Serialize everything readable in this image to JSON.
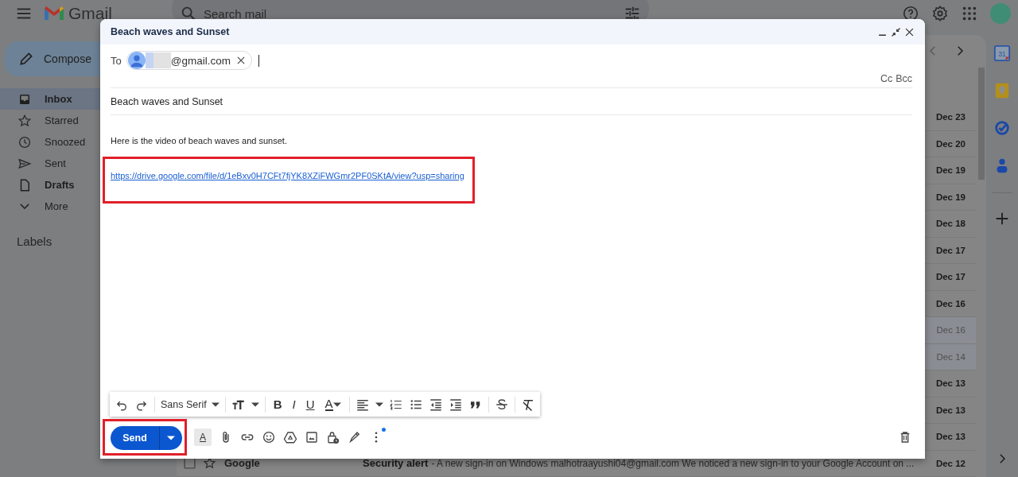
{
  "app": {
    "name": "Gmail"
  },
  "search": {
    "placeholder": "Search mail"
  },
  "top_icons": [
    {
      "kind": "help"
    },
    {
      "kind": "settings"
    },
    {
      "kind": "apps"
    },
    {
      "kind": "avatar"
    }
  ],
  "compose_button": {
    "label": "Compose"
  },
  "sidebar": {
    "items": [
      {
        "label": "Inbox",
        "selected": true,
        "bold": true
      },
      {
        "label": "Starred",
        "selected": false,
        "bold": false
      },
      {
        "label": "Snoozed",
        "selected": false,
        "bold": false
      },
      {
        "label": "Sent",
        "selected": false,
        "bold": false
      },
      {
        "label": "Drafts",
        "selected": false,
        "bold": true
      },
      {
        "label": "More",
        "selected": false,
        "bold": false
      }
    ],
    "labels_heading": "Labels"
  },
  "mail_list": {
    "rows": [
      {
        "date": "Dec 23",
        "unread": true
      },
      {
        "date": "Dec 20",
        "unread": true
      },
      {
        "date": "Dec 19",
        "unread": true
      },
      {
        "date": "Dec 19",
        "unread": true
      },
      {
        "date": "Dec 18",
        "unread": true
      },
      {
        "date": "Dec 17",
        "unread": true
      },
      {
        "date": "Dec 17",
        "unread": true
      },
      {
        "date": "Dec 16",
        "unread": true
      },
      {
        "date": "Dec 16",
        "unread": false
      },
      {
        "date": "Dec 14",
        "unread": false
      },
      {
        "date": "Dec 13",
        "unread": true
      },
      {
        "date": "Dec 13",
        "unread": true
      },
      {
        "date": "Dec 13",
        "unread": true
      },
      {
        "sender": "Google",
        "subject": "Security alert",
        "snippet": "- A new sign-in on Windows malhotraayushi04@gmail.com We noticed a new sign-in to your Google Account on ...",
        "date": "Dec 12",
        "unread": true
      }
    ]
  },
  "side_apps": [
    {
      "kind": "calendar",
      "label": "31"
    },
    {
      "kind": "keep"
    },
    {
      "kind": "tasks"
    },
    {
      "kind": "contacts"
    },
    {
      "kind": "add"
    }
  ],
  "compose": {
    "title": "Beach waves and Sunset",
    "to": {
      "label": "To",
      "recipient": "@gmail.com"
    },
    "cc": "Cc",
    "bcc": "Bcc",
    "subject": "Beach waves and Sunset",
    "body": "Here is the video of beach waves and sunset.",
    "link": "https://drive.google.com/file/d/1eBxv0H7CFt7fjYK8XZiFWGmr2PF0SKtA/view?usp=sharing",
    "link_highlighted": true,
    "toolbar": [
      {
        "kind": "undo"
      },
      {
        "kind": "redo"
      },
      {
        "kind": "sep"
      },
      {
        "kind": "font",
        "text": "Sans Serif"
      },
      {
        "kind": "sep"
      },
      {
        "kind": "size"
      },
      {
        "kind": "sep"
      },
      {
        "kind": "bold",
        "text": "B"
      },
      {
        "kind": "italic",
        "text": "I"
      },
      {
        "kind": "underline",
        "text": "U"
      },
      {
        "kind": "color",
        "text": "A"
      },
      {
        "kind": "sep"
      },
      {
        "kind": "align"
      },
      {
        "kind": "numbered"
      },
      {
        "kind": "bulleted"
      },
      {
        "kind": "outdent"
      },
      {
        "kind": "indent"
      },
      {
        "kind": "quote"
      },
      {
        "kind": "sep"
      },
      {
        "kind": "strike"
      },
      {
        "kind": "sep"
      },
      {
        "kind": "clear"
      }
    ],
    "send": "Send",
    "send_highlighted": true,
    "actions": [
      {
        "kind": "format",
        "text": "A"
      },
      {
        "kind": "attach"
      },
      {
        "kind": "link"
      },
      {
        "kind": "emoji"
      },
      {
        "kind": "drive"
      },
      {
        "kind": "photo"
      },
      {
        "kind": "confidential"
      },
      {
        "kind": "signature"
      },
      {
        "kind": "more",
        "notified": true
      }
    ]
  }
}
